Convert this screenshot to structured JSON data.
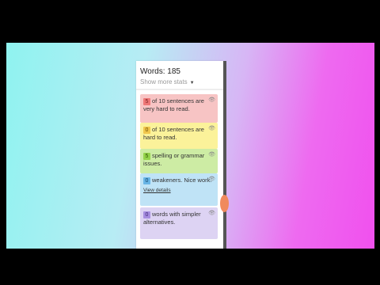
{
  "stats": {
    "word_count": "Words: 185",
    "more_stats_label": "Show more stats",
    "caret_icon": "chevron-down-icon"
  },
  "suggestions": [
    {
      "count": "5",
      "text": "of 10 sentences are very hard to read.",
      "color": "#f7c4c4",
      "icon": "eye-icon"
    },
    {
      "count": "0",
      "text": "of 10 sentences are hard to read.",
      "color": "#fbf29a",
      "icon": "eye-icon"
    },
    {
      "count": "5",
      "text": "spelling or grammar issues.",
      "color": "#cdeca4",
      "icon": "eye-icon"
    },
    {
      "count": "0",
      "text": "weakeners. Nice work.",
      "color": "#bfe3f6",
      "icon": "eye-icon",
      "link": "View details"
    },
    {
      "count": "0",
      "text": "words with simpler alternatives.",
      "color": "#ddd3f3",
      "icon": "eye-icon"
    }
  ]
}
